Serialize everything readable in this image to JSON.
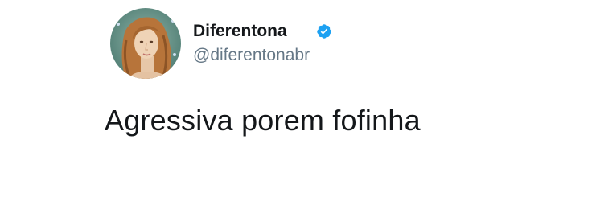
{
  "tweet": {
    "author": {
      "display_name": "Diferentona",
      "handle": "@diferentonabr",
      "verified": true,
      "avatar_icon": "venus-portrait-avatar"
    },
    "text": "Agressiva porem fofinha"
  },
  "colors": {
    "background": "#ffffff",
    "text_primary": "#14171a",
    "text_secondary": "#657786",
    "verified_badge": "#1da1f2"
  }
}
